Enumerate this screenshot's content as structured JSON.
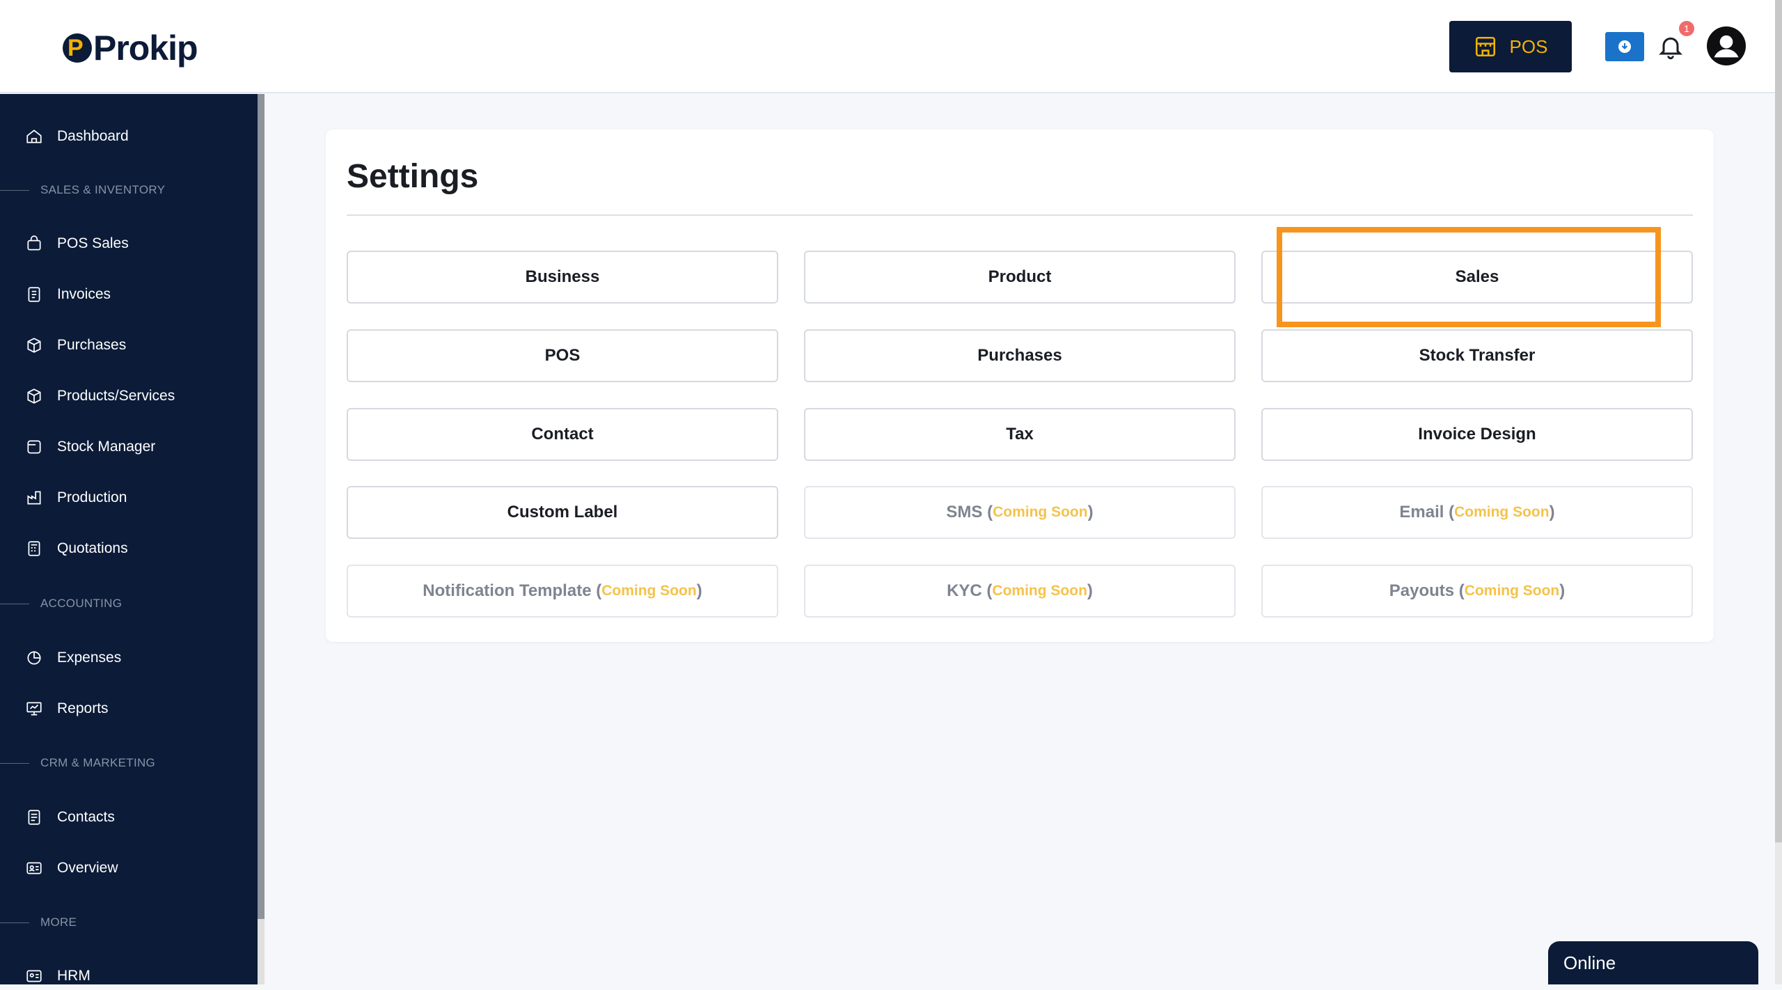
{
  "header": {
    "brand": "Prokip",
    "pos_label": "POS",
    "notification_count": "1"
  },
  "sidebar": {
    "dashboard": "Dashboard",
    "sections": {
      "sales_inventory": "SALES & INVENTORY",
      "accounting": "ACCOUNTING",
      "crm_marketing": "CRM & MARKETING",
      "more": "MORE"
    },
    "items": {
      "pos_sales": "POS Sales",
      "invoices": "Invoices",
      "purchases": "Purchases",
      "products_services": "Products/Services",
      "stock_manager": "Stock Manager",
      "production": "Production",
      "quotations": "Quotations",
      "expenses": "Expenses",
      "reports": "Reports",
      "contacts": "Contacts",
      "overview": "Overview",
      "hrm": "HRM"
    }
  },
  "main": {
    "title": "Settings",
    "coming_soon": "Coming Soon",
    "tiles": {
      "business": "Business",
      "product": "Product",
      "sales": "Sales",
      "pos": "POS",
      "purchases": "Purchases",
      "stock_transfer": "Stock Transfer",
      "contact": "Contact",
      "tax": "Tax",
      "invoice_design": "Invoice Design",
      "custom_label": "Custom Label",
      "sms": "SMS",
      "email": "Email",
      "notification_template": "Notification Template",
      "kyc": "KYC",
      "payouts": "Payouts"
    }
  },
  "status": {
    "online": "Online"
  },
  "colors": {
    "sidebar_bg": "#0b1b38",
    "accent_yellow": "#f5b100",
    "highlight_orange": "#f7941d",
    "download_blue": "#1a73c9"
  }
}
